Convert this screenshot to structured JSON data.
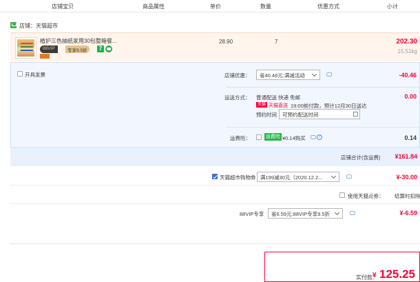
{
  "columns": [
    "店铺宝贝",
    "商品属性",
    "单价",
    "数量",
    "优惠方式",
    "小计"
  ],
  "shop": {
    "label": "店铺：天猫超市"
  },
  "product": {
    "name": "植护三色抽纸家用30包整箱餐...",
    "vip_badge": "88VIP",
    "vip_discount": "专享9.5折",
    "seven_badge": "7",
    "unit_price": "28.90",
    "quantity": "7",
    "subtotal": "202.30",
    "weight": "15.51kg"
  },
  "invoice": {
    "label": "开具发票"
  },
  "shop_discount": {
    "label": "店铺优惠：",
    "option": "省40.46元:满减活动",
    "amount": "-40.46"
  },
  "shipping": {
    "label": "运送方式：",
    "method": "普通配送 快递 免邮",
    "tmall_tag": "天猫",
    "tmall_text": "天猫直送",
    "eta": "19:00前付款，预计12月30日送达",
    "reserve_label": "预约时间",
    "reserve_placeholder": "可预约配送时间",
    "amount": "0.00"
  },
  "insurance": {
    "label": "运费险：",
    "tag": "运费险",
    "text": "¥0.14购买",
    "amount": "0.14"
  },
  "shop_total": {
    "label": "店铺合计(含运费)",
    "amount": "¥161.84"
  },
  "coupon": {
    "label": "天猫超市购物券",
    "option": "满199减30元（2020.12.2...",
    "amount": "¥-30.00"
  },
  "tmall_points": {
    "label": "使用天猫点券：",
    "text": "结算时扣除"
  },
  "vip": {
    "label": "88VIP专享",
    "option": "省6.59元:88VIP专享9.5折",
    "amount": "¥-6.59"
  },
  "summary": {
    "pay_label": "实付款：",
    "currency": "¥",
    "pay_amount": "125.25"
  },
  "colors": {
    "accent_red": "#ff0036",
    "panel_bg": "#f2f7ff",
    "product_bg": "#fff5ec",
    "tmall_green": "#3cb34a"
  }
}
